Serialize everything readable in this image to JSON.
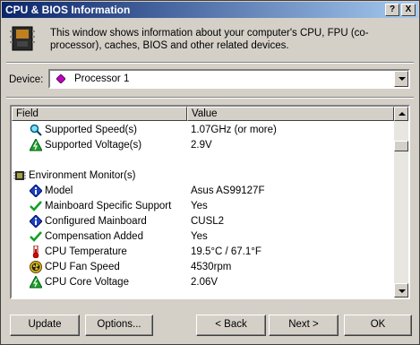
{
  "window": {
    "title": "CPU & BIOS Information",
    "help_glyph": "?",
    "close_glyph": "X"
  },
  "info_text": "This window shows information about your computer's CPU, FPU (co-processor), caches, BIOS and other related devices.",
  "device": {
    "label": "Device:",
    "selected": "Processor 1"
  },
  "table": {
    "columns": [
      "Field",
      "Value"
    ],
    "rows": [
      {
        "field": "Supported Speed(s)",
        "value": "1.07GHz  (or more)",
        "icon": "magnifier-icon"
      },
      {
        "field": "Supported Voltage(s)",
        "value": "2.9V",
        "icon": "voltage-icon"
      },
      {
        "field": "Environment Monitor(s)",
        "value": "",
        "icon": "chip-icon"
      },
      {
        "field": "Model",
        "value": "Asus AS99127F",
        "icon": "info-icon"
      },
      {
        "field": "Mainboard Specific Support",
        "value": "Yes",
        "icon": "checkmark-icon"
      },
      {
        "field": "Configured Mainboard",
        "value": "CUSL2",
        "icon": "info-icon"
      },
      {
        "field": "Compensation Added",
        "value": "Yes",
        "icon": "checkmark-icon"
      },
      {
        "field": "CPU Temperature",
        "value": "19.5°C / 67.1°F",
        "icon": "thermometer-icon"
      },
      {
        "field": "CPU Fan Speed",
        "value": "4530rpm",
        "icon": "fan-icon"
      },
      {
        "field": "CPU Core Voltage",
        "value": "2.06V",
        "icon": "voltage-icon"
      }
    ]
  },
  "buttons": {
    "update": "Update",
    "options": "Options...",
    "back": "< Back",
    "next": "Next >",
    "ok": "OK"
  },
  "colors": {
    "titlebar_start": "#0a246a",
    "titlebar_end": "#a6caf0",
    "face": "#d4d0c8"
  }
}
